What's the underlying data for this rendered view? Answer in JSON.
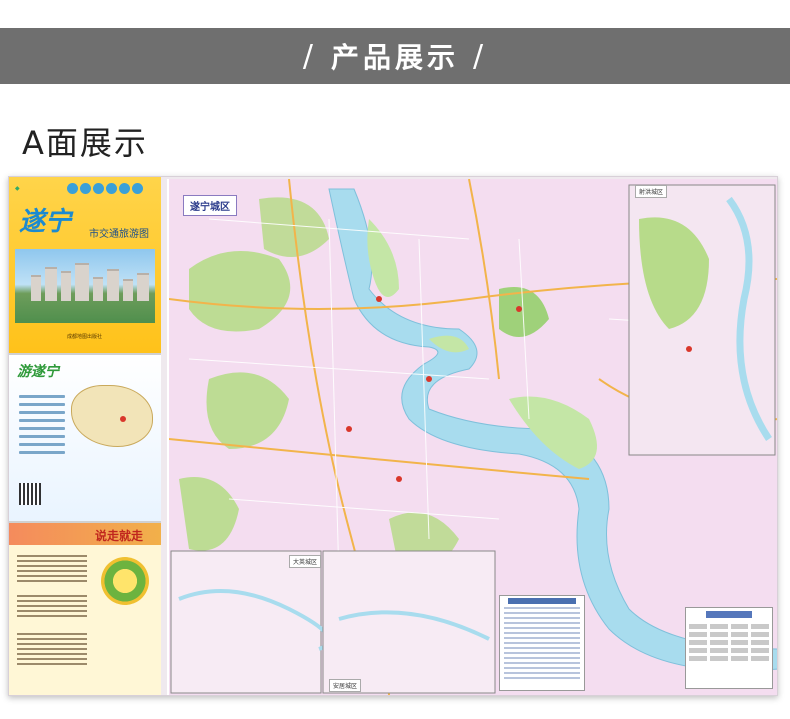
{
  "banner": {
    "title": "产品展示",
    "slash_left": "/",
    "slash_right": "/"
  },
  "section": {
    "title": "A面展示"
  },
  "cover": {
    "city_name": "遂宁",
    "subtitle": "市交通旅游图",
    "publisher": "成都地图出版社"
  },
  "brochure": {
    "mid_title": "游遂宁",
    "bottom_title": "说走就走"
  },
  "map": {
    "main_label": "遂宁城区",
    "inset_shehong": "射洪城区",
    "inset_daying": "大英城区",
    "inset_anju": "安居城区"
  },
  "colors": {
    "banner_bg": "#6f6f6f",
    "cover_yellow": "#ffc21a",
    "river_blue": "#a8dcee",
    "park_green": "#a9d47a",
    "map_pink": "#f4ddf0"
  }
}
